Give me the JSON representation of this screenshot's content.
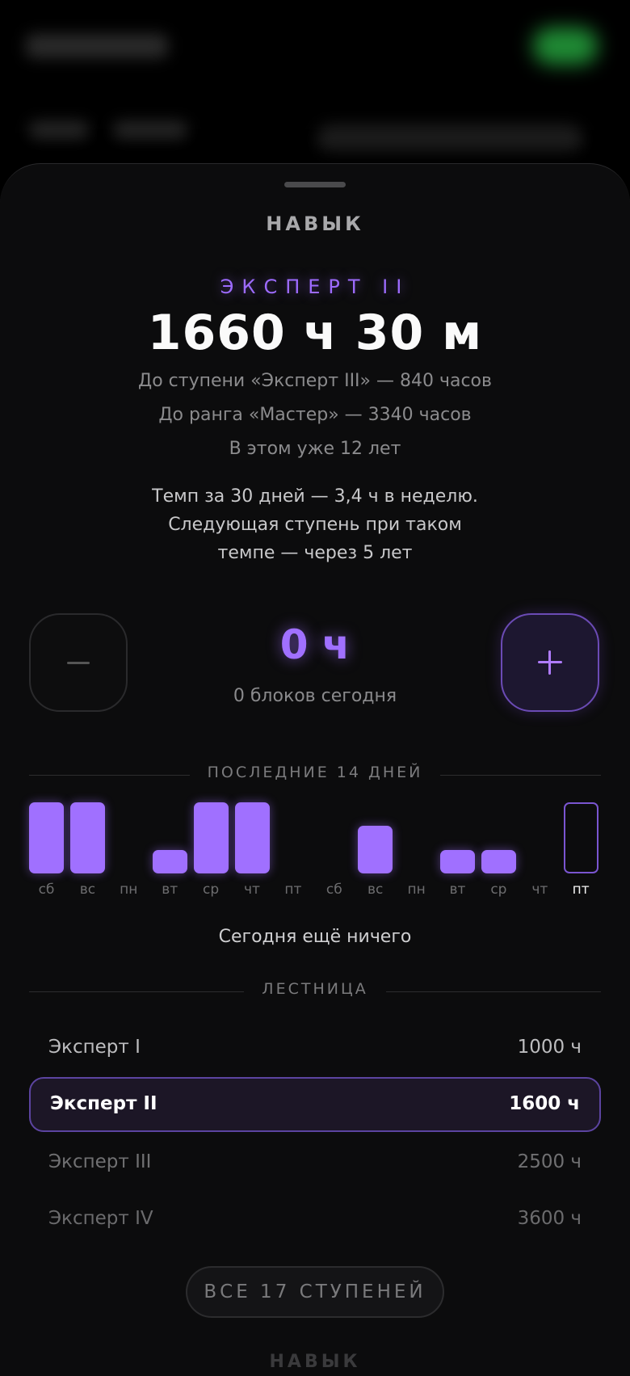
{
  "sheet": {
    "title": "НАВЫК",
    "rank": "ЭКСПЕРТ II",
    "total_time": "1660 ч 30 м",
    "to_next_step": "До ступени «Эксперт III» — 840 часов",
    "to_next_rank": "До ранга «Мастер» — 3340 часов",
    "years": "В этом уже 12 лет",
    "pace_lines": [
      "Темп за 30 дней — 3,4 ч в неделю.",
      "Следующая ступень при таком",
      "темпе — через 5 лет"
    ]
  },
  "counter": {
    "value": "0 ч",
    "subtitle": "0 блоков сегодня",
    "minus_icon": "minus-icon",
    "plus_icon": "plus-icon"
  },
  "history": {
    "heading": "ПОСЛЕДНИЕ 14 ДНЕЙ",
    "days": [
      "сб",
      "вс",
      "пн",
      "вт",
      "ср",
      "чт",
      "пт",
      "сб",
      "вс",
      "пн",
      "вт",
      "ср",
      "чт",
      "пт"
    ],
    "levels": [
      1.0,
      1.0,
      0,
      0.33,
      1.0,
      1.0,
      0,
      0,
      0.67,
      0,
      0.33,
      0.33,
      0,
      0
    ],
    "today_index": 13,
    "today_message": "Сегодня ещё ничего"
  },
  "ladder": {
    "heading": "ЛЕСТНИЦА",
    "steps": [
      {
        "name": "Эксперт I",
        "hours": "1000 ч"
      },
      {
        "name": "Эксперт II",
        "hours": "1600 ч",
        "current": true
      },
      {
        "name": "Эксперт III",
        "hours": "2500 ч"
      },
      {
        "name": "Эксперт IV",
        "hours": "3600 ч"
      }
    ],
    "all_button": "ВСЕ 17 СТУПЕНЕЙ"
  },
  "colors": {
    "accent": "#a070ff",
    "background": "#0c0c0d"
  }
}
